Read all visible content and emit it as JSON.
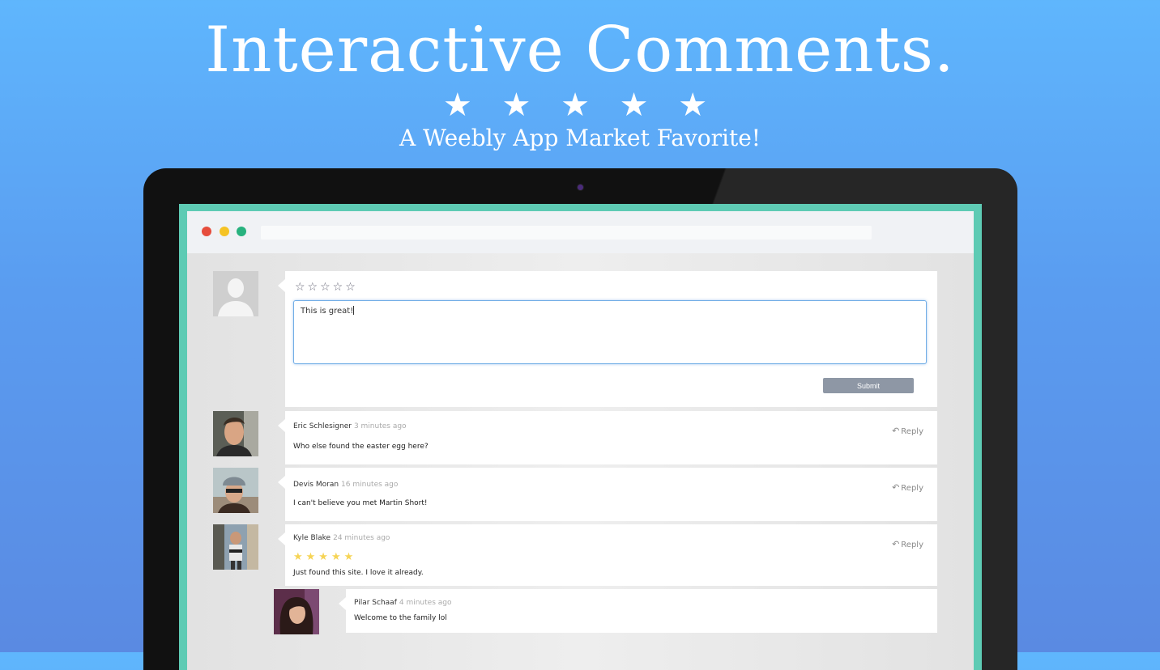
{
  "hero": {
    "title": "Interactive Comments.",
    "stars": "★ ★ ★ ★ ★",
    "subtitle": "A Weebly App Market Favorite!"
  },
  "compose": {
    "rating_stars": "☆☆☆☆☆",
    "text": "This is great!",
    "submit_label": "Submit"
  },
  "comments": [
    {
      "author": "Eric Schlesigner",
      "time": "3 minutes ago",
      "text": "Who else found the easter egg here?",
      "reply_label": "Reply"
    },
    {
      "author": "Devis Moran",
      "time": "16 minutes ago",
      "text": "I can't believe you met Martin Short!",
      "reply_label": "Reply"
    },
    {
      "author": "Kyle Blake",
      "time": "24 minutes ago",
      "rating": 5,
      "rating_stars": "★★★★★",
      "text": "Just found this site. I love it already.",
      "reply_label": "Reply"
    },
    {
      "author": "Pilar Schaaf",
      "time": "4 minutes ago",
      "text": "Welcome to the family lol"
    }
  ],
  "colors": {
    "background_top": "#5fb6fd",
    "screen_accent": "#5ecbb4",
    "submit_button": "#8e97a5",
    "star_gold": "#f6d455",
    "traffic_red": "#e64d3c",
    "traffic_yellow": "#f5c324",
    "traffic_green": "#27b27e"
  }
}
